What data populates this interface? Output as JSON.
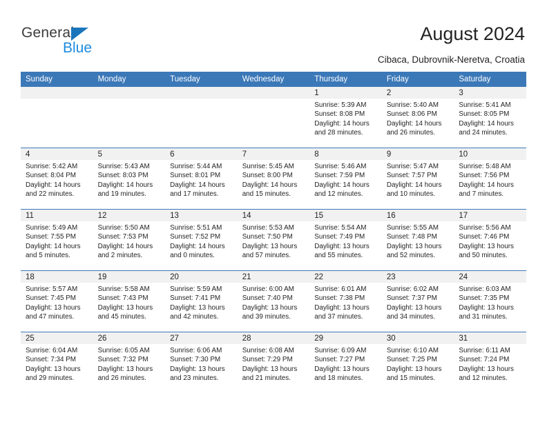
{
  "brand": {
    "name_top": "General",
    "name_bottom": "Blue",
    "triangle_color": "#1b75bb",
    "blue_text_color": "#1b8ae0"
  },
  "header": {
    "title": "August 2024",
    "location": "Cibaca, Dubrovnik-Neretva, Croatia",
    "accent_color": "#3b78b8",
    "daynum_band_color": "#f1f1f1"
  },
  "weekdays": [
    "Sunday",
    "Monday",
    "Tuesday",
    "Wednesday",
    "Thursday",
    "Friday",
    "Saturday"
  ],
  "weeks": [
    [
      {
        "day": ""
      },
      {
        "day": ""
      },
      {
        "day": ""
      },
      {
        "day": ""
      },
      {
        "day": "1",
        "sunrise": "Sunrise: 5:39 AM",
        "sunset": "Sunset: 8:08 PM",
        "daylight_1": "Daylight: 14 hours",
        "daylight_2": "and 28 minutes."
      },
      {
        "day": "2",
        "sunrise": "Sunrise: 5:40 AM",
        "sunset": "Sunset: 8:06 PM",
        "daylight_1": "Daylight: 14 hours",
        "daylight_2": "and 26 minutes."
      },
      {
        "day": "3",
        "sunrise": "Sunrise: 5:41 AM",
        "sunset": "Sunset: 8:05 PM",
        "daylight_1": "Daylight: 14 hours",
        "daylight_2": "and 24 minutes."
      }
    ],
    [
      {
        "day": "4",
        "sunrise": "Sunrise: 5:42 AM",
        "sunset": "Sunset: 8:04 PM",
        "daylight_1": "Daylight: 14 hours",
        "daylight_2": "and 22 minutes."
      },
      {
        "day": "5",
        "sunrise": "Sunrise: 5:43 AM",
        "sunset": "Sunset: 8:03 PM",
        "daylight_1": "Daylight: 14 hours",
        "daylight_2": "and 19 minutes."
      },
      {
        "day": "6",
        "sunrise": "Sunrise: 5:44 AM",
        "sunset": "Sunset: 8:01 PM",
        "daylight_1": "Daylight: 14 hours",
        "daylight_2": "and 17 minutes."
      },
      {
        "day": "7",
        "sunrise": "Sunrise: 5:45 AM",
        "sunset": "Sunset: 8:00 PM",
        "daylight_1": "Daylight: 14 hours",
        "daylight_2": "and 15 minutes."
      },
      {
        "day": "8",
        "sunrise": "Sunrise: 5:46 AM",
        "sunset": "Sunset: 7:59 PM",
        "daylight_1": "Daylight: 14 hours",
        "daylight_2": "and 12 minutes."
      },
      {
        "day": "9",
        "sunrise": "Sunrise: 5:47 AM",
        "sunset": "Sunset: 7:57 PM",
        "daylight_1": "Daylight: 14 hours",
        "daylight_2": "and 10 minutes."
      },
      {
        "day": "10",
        "sunrise": "Sunrise: 5:48 AM",
        "sunset": "Sunset: 7:56 PM",
        "daylight_1": "Daylight: 14 hours",
        "daylight_2": "and 7 minutes."
      }
    ],
    [
      {
        "day": "11",
        "sunrise": "Sunrise: 5:49 AM",
        "sunset": "Sunset: 7:55 PM",
        "daylight_1": "Daylight: 14 hours",
        "daylight_2": "and 5 minutes."
      },
      {
        "day": "12",
        "sunrise": "Sunrise: 5:50 AM",
        "sunset": "Sunset: 7:53 PM",
        "daylight_1": "Daylight: 14 hours",
        "daylight_2": "and 2 minutes."
      },
      {
        "day": "13",
        "sunrise": "Sunrise: 5:51 AM",
        "sunset": "Sunset: 7:52 PM",
        "daylight_1": "Daylight: 14 hours",
        "daylight_2": "and 0 minutes."
      },
      {
        "day": "14",
        "sunrise": "Sunrise: 5:53 AM",
        "sunset": "Sunset: 7:50 PM",
        "daylight_1": "Daylight: 13 hours",
        "daylight_2": "and 57 minutes."
      },
      {
        "day": "15",
        "sunrise": "Sunrise: 5:54 AM",
        "sunset": "Sunset: 7:49 PM",
        "daylight_1": "Daylight: 13 hours",
        "daylight_2": "and 55 minutes."
      },
      {
        "day": "16",
        "sunrise": "Sunrise: 5:55 AM",
        "sunset": "Sunset: 7:48 PM",
        "daylight_1": "Daylight: 13 hours",
        "daylight_2": "and 52 minutes."
      },
      {
        "day": "17",
        "sunrise": "Sunrise: 5:56 AM",
        "sunset": "Sunset: 7:46 PM",
        "daylight_1": "Daylight: 13 hours",
        "daylight_2": "and 50 minutes."
      }
    ],
    [
      {
        "day": "18",
        "sunrise": "Sunrise: 5:57 AM",
        "sunset": "Sunset: 7:45 PM",
        "daylight_1": "Daylight: 13 hours",
        "daylight_2": "and 47 minutes."
      },
      {
        "day": "19",
        "sunrise": "Sunrise: 5:58 AM",
        "sunset": "Sunset: 7:43 PM",
        "daylight_1": "Daylight: 13 hours",
        "daylight_2": "and 45 minutes."
      },
      {
        "day": "20",
        "sunrise": "Sunrise: 5:59 AM",
        "sunset": "Sunset: 7:41 PM",
        "daylight_1": "Daylight: 13 hours",
        "daylight_2": "and 42 minutes."
      },
      {
        "day": "21",
        "sunrise": "Sunrise: 6:00 AM",
        "sunset": "Sunset: 7:40 PM",
        "daylight_1": "Daylight: 13 hours",
        "daylight_2": "and 39 minutes."
      },
      {
        "day": "22",
        "sunrise": "Sunrise: 6:01 AM",
        "sunset": "Sunset: 7:38 PM",
        "daylight_1": "Daylight: 13 hours",
        "daylight_2": "and 37 minutes."
      },
      {
        "day": "23",
        "sunrise": "Sunrise: 6:02 AM",
        "sunset": "Sunset: 7:37 PM",
        "daylight_1": "Daylight: 13 hours",
        "daylight_2": "and 34 minutes."
      },
      {
        "day": "24",
        "sunrise": "Sunrise: 6:03 AM",
        "sunset": "Sunset: 7:35 PM",
        "daylight_1": "Daylight: 13 hours",
        "daylight_2": "and 31 minutes."
      }
    ],
    [
      {
        "day": "25",
        "sunrise": "Sunrise: 6:04 AM",
        "sunset": "Sunset: 7:34 PM",
        "daylight_1": "Daylight: 13 hours",
        "daylight_2": "and 29 minutes."
      },
      {
        "day": "26",
        "sunrise": "Sunrise: 6:05 AM",
        "sunset": "Sunset: 7:32 PM",
        "daylight_1": "Daylight: 13 hours",
        "daylight_2": "and 26 minutes."
      },
      {
        "day": "27",
        "sunrise": "Sunrise: 6:06 AM",
        "sunset": "Sunset: 7:30 PM",
        "daylight_1": "Daylight: 13 hours",
        "daylight_2": "and 23 minutes."
      },
      {
        "day": "28",
        "sunrise": "Sunrise: 6:08 AM",
        "sunset": "Sunset: 7:29 PM",
        "daylight_1": "Daylight: 13 hours",
        "daylight_2": "and 21 minutes."
      },
      {
        "day": "29",
        "sunrise": "Sunrise: 6:09 AM",
        "sunset": "Sunset: 7:27 PM",
        "daylight_1": "Daylight: 13 hours",
        "daylight_2": "and 18 minutes."
      },
      {
        "day": "30",
        "sunrise": "Sunrise: 6:10 AM",
        "sunset": "Sunset: 7:25 PM",
        "daylight_1": "Daylight: 13 hours",
        "daylight_2": "and 15 minutes."
      },
      {
        "day": "31",
        "sunrise": "Sunrise: 6:11 AM",
        "sunset": "Sunset: 7:24 PM",
        "daylight_1": "Daylight: 13 hours",
        "daylight_2": "and 12 minutes."
      }
    ]
  ]
}
